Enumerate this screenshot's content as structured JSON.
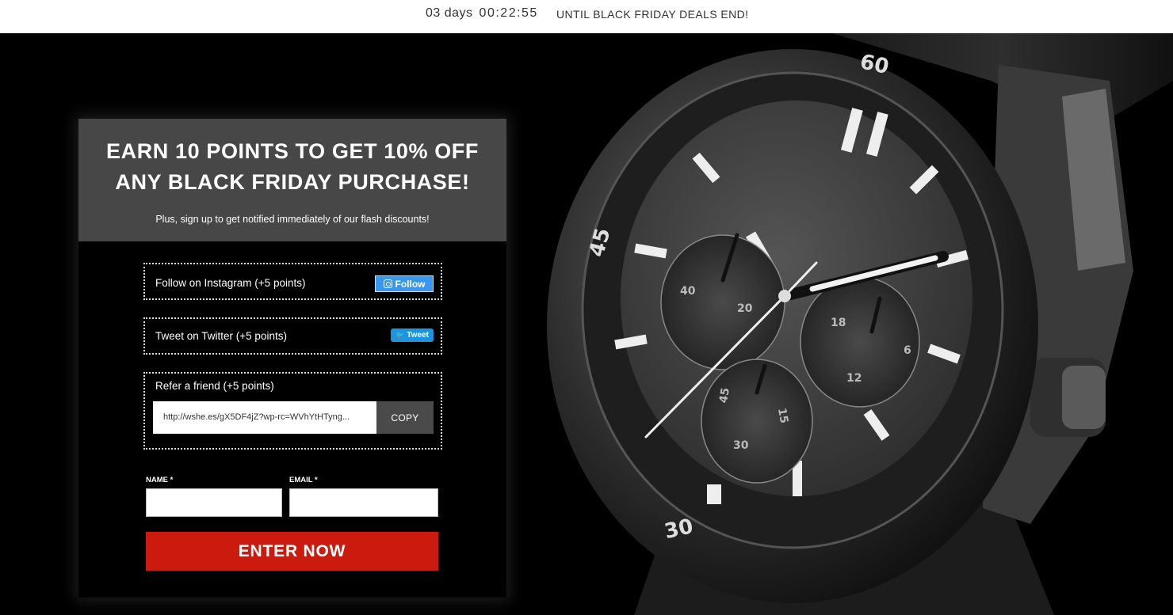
{
  "countdown": {
    "days": "03 days",
    "time": "00:22:55",
    "message": "UNTIL BLACK FRIDAY DEALS END!"
  },
  "card": {
    "headline_line1": "EARN 10 POINTS TO GET 10% OFF",
    "headline_line2": "ANY BLACK FRIDAY PURCHASE!",
    "subline": "Plus, sign up to get notified immediately of our flash discounts!"
  },
  "actions": [
    {
      "label": "Follow on Instagram (+5 points)",
      "button": "Follow",
      "icon": "instagram-icon"
    },
    {
      "label": "Tweet on Twitter  (+5 points)",
      "button": "Tweet",
      "icon": "twitter-bird-icon"
    },
    {
      "label": "Refer a friend (+5 points)",
      "referral_link": "http://wshe.es/gX5DF4jZ?wp-rc=WVhYtHTyng...",
      "button": "COPY"
    }
  ],
  "form": {
    "name_label": "NAME *",
    "email_label": "EMAIL *",
    "name_value": "",
    "email_value": "",
    "submit_label": "ENTER NOW"
  },
  "watch": {
    "bezel_numbers": [
      "60",
      "45",
      "30"
    ],
    "subdial_left_numbers": [
      "40",
      "20"
    ],
    "subdial_right_numbers": [
      "18",
      "6",
      "12"
    ],
    "subdial_bottom_numbers": [
      "45",
      "15",
      "30"
    ]
  },
  "colors": {
    "instagram_blue": "#3897f0",
    "twitter_blue": "#1b95e0",
    "cta_red": "#cc1b0e",
    "header_gray": "#474747"
  }
}
